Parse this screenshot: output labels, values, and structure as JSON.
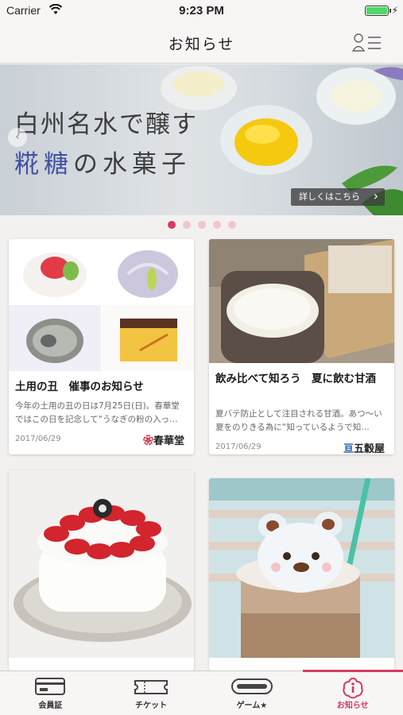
{
  "status_bar": {
    "carrier": "Carrier",
    "time": "9:23 PM",
    "battery_level": 1.0
  },
  "nav": {
    "title": "お知らせ"
  },
  "banner": {
    "line1": "白州名水で醸す",
    "line2_accent": "糀糖",
    "line2_rest": "の水菓子",
    "more_label": "詳しくはこちら",
    "slide_count": 5,
    "active_slide": 0
  },
  "cards": [
    {
      "title": "土用の丑　催事のお知らせ",
      "desc": "今年の土用の丑の日は7月25日(日)。春華堂ではこの日を記念して“うなぎの粉の入っ…",
      "date": "2017/06/29",
      "logo_mark": "❀",
      "logo_text": "春華堂"
    },
    {
      "title": "飲み比べて知ろう　夏に飲む甘酒",
      "desc": "夏バテ防止として注目される甘酒。あつ〜い夏をのりきる為に“知っているようで知…",
      "date": "2017/06/29",
      "logo_mark": "亘",
      "logo_text": "五穀屋"
    }
  ],
  "tabs": [
    {
      "label": "会員証",
      "icon": "member-card-icon"
    },
    {
      "label": "チケット",
      "icon": "ticket-icon"
    },
    {
      "label": "ゲーム★",
      "icon": "game-icon"
    },
    {
      "label": "お知らせ",
      "icon": "notice-icon"
    }
  ],
  "colors": {
    "accent": "#d73a5f",
    "banner_accent": "#4050a0"
  }
}
